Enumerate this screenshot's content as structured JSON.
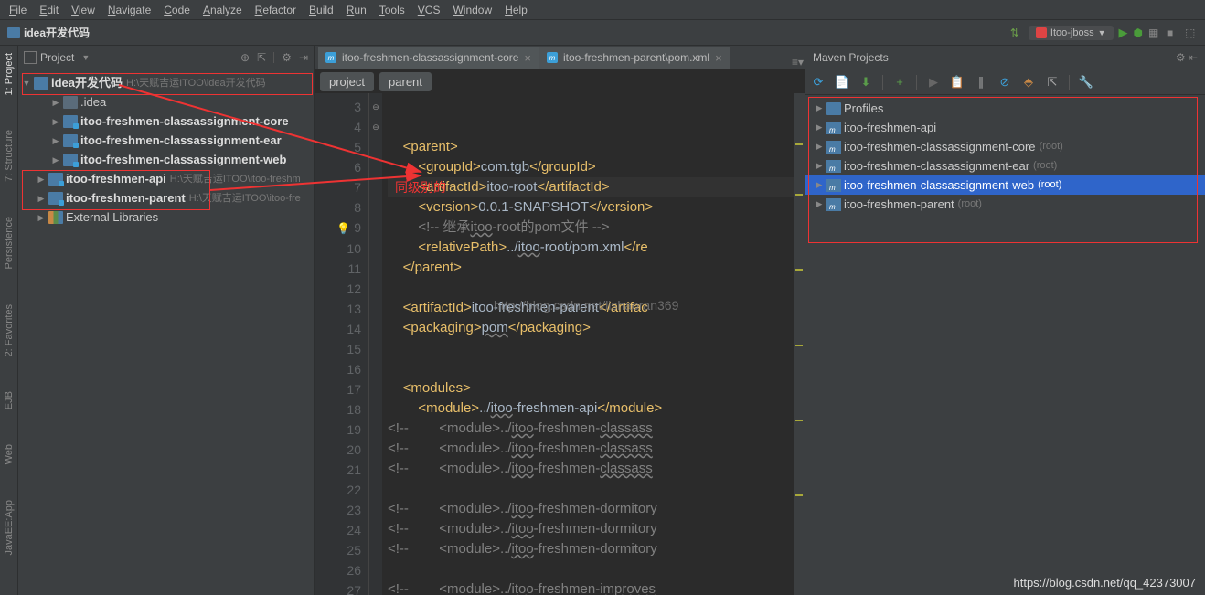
{
  "menu": [
    "File",
    "Edit",
    "View",
    "Navigate",
    "Code",
    "Analyze",
    "Refactor",
    "Build",
    "Run",
    "Tools",
    "VCS",
    "Window",
    "Help"
  ],
  "nav": {
    "path": "idea开发代码",
    "run_config": "Itoo-jboss"
  },
  "project_panel": {
    "title": "Project"
  },
  "tree": {
    "root": {
      "label": "idea开发代码",
      "hint": "H:\\天赋吉运ITOO\\idea开发代码"
    },
    "items": [
      {
        "label": ".idea",
        "type": "folder-dark",
        "indent": 1,
        "arrow": "▶"
      },
      {
        "label": "itoo-freshmen-classassignment-core",
        "type": "module",
        "indent": 1,
        "arrow": "▶",
        "bold": true
      },
      {
        "label": "itoo-freshmen-classassignment-ear",
        "type": "module",
        "indent": 1,
        "arrow": "▶",
        "bold": true
      },
      {
        "label": "itoo-freshmen-classassignment-web",
        "type": "module",
        "indent": 1,
        "arrow": "▶",
        "bold": true
      },
      {
        "label": "itoo-freshmen-api",
        "type": "module",
        "indent": 0,
        "arrow": "▶",
        "bold": true,
        "hint": "H:\\天赋吉运ITOO\\itoo-freshm"
      },
      {
        "label": "itoo-freshmen-parent",
        "type": "module",
        "indent": 0,
        "arrow": "▶",
        "bold": true,
        "hint": "H:\\天赋吉运ITOO\\itoo-fre"
      },
      {
        "label": "External Libraries",
        "type": "lib",
        "indent": 0,
        "arrow": "▶"
      }
    ]
  },
  "editor": {
    "tabs": [
      {
        "label": "itoo-freshmen-classassignment-core",
        "active": false
      },
      {
        "label": "itoo-freshmen-parent\\pom.xml",
        "active": true
      }
    ],
    "breadcrumbs": [
      "project",
      "parent"
    ],
    "lines": [
      {
        "n": 3,
        "html": ""
      },
      {
        "n": 4,
        "html": ""
      },
      {
        "n": 5,
        "html": "    <span class='tag'>&lt;parent&gt;</span>"
      },
      {
        "n": 6,
        "html": "        <span class='tag'>&lt;groupId&gt;</span>com.tgb<span class='tag'>&lt;/groupId&gt;</span>"
      },
      {
        "n": 7,
        "html": "        <span class='tag'>&lt;artifactId&gt;</span>itoo-root<span class='tag'>&lt;/artifactId&gt;</span>",
        "caret": true
      },
      {
        "n": 8,
        "html": "        <span class='tag'>&lt;version&gt;</span>0.0.1-SNAPSHOT<span class='tag'>&lt;/version&gt;</span>"
      },
      {
        "n": 9,
        "html": "        <span class='cmt'>&lt;!-- 继承<span class='wavy'>itoo</span>-root的pom文件 --&gt;</span>",
        "bulb": true
      },
      {
        "n": 10,
        "html": "        <span class='tag'>&lt;relativePath&gt;</span>../<span class='wavy'>itoo</span>-root/pom.xml<span class='tag'>&lt;/re</span>"
      },
      {
        "n": 11,
        "html": "    <span class='tag'>&lt;/parent&gt;</span>"
      },
      {
        "n": 12,
        "html": ""
      },
      {
        "n": 13,
        "html": "    <span class='tag'>&lt;artifactId&gt;</span>itoo-freshmen-parent<span class='tag'>&lt;/artifac</span>"
      },
      {
        "n": 14,
        "html": "    <span class='tag'>&lt;packaging&gt;</span><span class='wavy'>pom</span><span class='tag'>&lt;/packaging&gt;</span>"
      },
      {
        "n": 15,
        "html": ""
      },
      {
        "n": 16,
        "html": ""
      },
      {
        "n": 17,
        "html": "    <span class='tag'>&lt;modules&gt;</span>"
      },
      {
        "n": 18,
        "html": "        <span class='tag'>&lt;module&gt;</span>../<span class='wavy'>itoo</span>-freshmen-api<span class='tag'>&lt;/module&gt;</span>"
      },
      {
        "n": 19,
        "html": "<span class='cmt'>&lt;!--        &lt;module&gt;../<span class='wavy'>itoo</span>-freshmen-<span class='wavy'>classass</span></span>"
      },
      {
        "n": 20,
        "html": "<span class='cmt'>&lt;!--        &lt;module&gt;../<span class='wavy'>itoo</span>-freshmen-<span class='wavy'>classass</span></span>"
      },
      {
        "n": 21,
        "html": "<span class='cmt'>&lt;!--        &lt;module&gt;../<span class='wavy'>itoo</span>-freshmen-<span class='wavy'>classass</span></span>"
      },
      {
        "n": 22,
        "html": ""
      },
      {
        "n": 23,
        "html": "<span class='cmt'>&lt;!--        &lt;module&gt;../<span class='wavy'>itoo</span>-freshmen-dormitory</span>"
      },
      {
        "n": 24,
        "html": "<span class='cmt'>&lt;!--        &lt;module&gt;../<span class='wavy'>itoo</span>-freshmen-dormitory</span>"
      },
      {
        "n": 25,
        "html": "<span class='cmt'>&lt;!--        &lt;module&gt;../<span class='wavy'>itoo</span>-freshmen-dormitory</span>"
      },
      {
        "n": 26,
        "html": ""
      },
      {
        "n": 27,
        "html": "<span class='cmt'>&lt;!--        &lt;module&gt;../<span class='wavy'>itoo</span>-freshmen-<span class='wavy'>improves</span></span>"
      }
    ]
  },
  "maven": {
    "title": "Maven Projects",
    "items": [
      {
        "label": "Profiles",
        "type": "folder",
        "arrow": "▶"
      },
      {
        "label": "itoo-freshmen-api",
        "type": "maven",
        "arrow": "▶"
      },
      {
        "label": "itoo-freshmen-classassignment-core",
        "type": "maven",
        "arrow": "▶",
        "hint": "(root)"
      },
      {
        "label": "itoo-freshmen-classassignment-ear",
        "type": "maven",
        "arrow": "▶",
        "hint": "(root)"
      },
      {
        "label": "itoo-freshmen-classassignment-web",
        "type": "maven",
        "arrow": "▶",
        "hint": "(root)",
        "selected": true
      },
      {
        "label": "itoo-freshmen-parent",
        "type": "maven",
        "arrow": "▶",
        "hint": "(root)"
      }
    ]
  },
  "annotations": {
    "red_text": "同级别的",
    "watermark": "http://blog.csdn.net/lishaoran369",
    "footer": "https://blog.csdn.net/qq_42373007"
  }
}
